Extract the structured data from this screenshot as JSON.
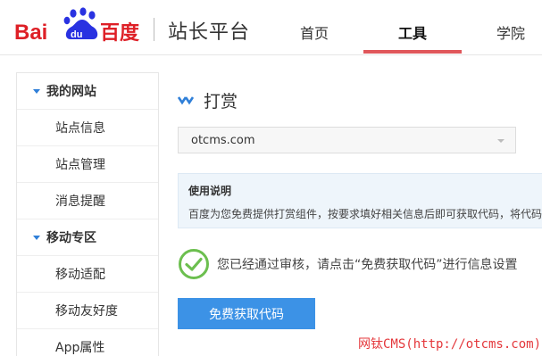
{
  "header": {
    "logo": {
      "text_bai": "Bai",
      "text_du": "du",
      "text_cn": "百度"
    },
    "site_title": "站长平台",
    "nav": [
      {
        "label": "首页"
      },
      {
        "label": "工具",
        "active": true
      },
      {
        "label": "学院"
      }
    ],
    "accent_color": "#e0575b"
  },
  "sidebar": {
    "items": [
      {
        "label": "我的网站",
        "type": "group"
      },
      {
        "label": "站点信息",
        "type": "sub"
      },
      {
        "label": "站点管理",
        "type": "sub"
      },
      {
        "label": "消息提醒",
        "type": "sub"
      },
      {
        "label": "移动专区",
        "type": "group"
      },
      {
        "label": "移动适配",
        "type": "sub"
      },
      {
        "label": "移动友好度",
        "type": "sub"
      },
      {
        "label": "App属性",
        "type": "sub"
      }
    ]
  },
  "main": {
    "title": "打赏",
    "title_icon": "double-chevron-icon",
    "site_select": {
      "value": "otcms.com"
    },
    "info": {
      "title": "使用说明",
      "text": "百度为您免费提供打赏组件，按要求填好相关信息后即可获取代码，将代码放"
    },
    "status": {
      "icon": "check-circle-icon",
      "text": "您已经通过审核，请点击“免费获取代码”进行信息设置",
      "color": "#6cbf4f"
    },
    "get_code_button": "免费获取代码",
    "button_color": "#3c92e6"
  },
  "watermark": "网钛CMS(http://otcms.com)"
}
